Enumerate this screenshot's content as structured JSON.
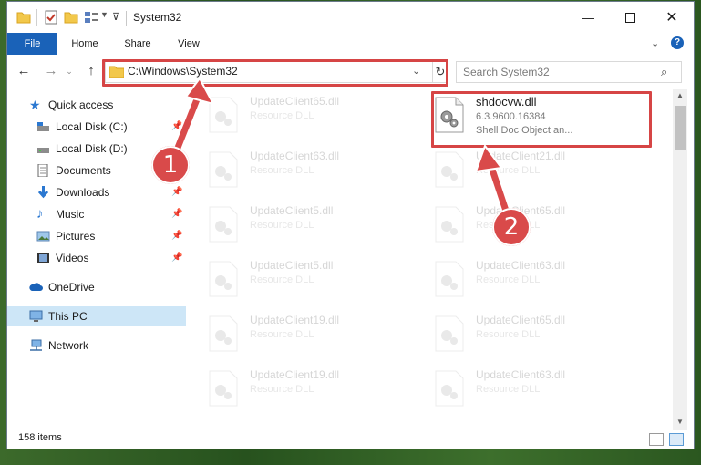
{
  "window": {
    "title": "System32"
  },
  "ribbon": {
    "tabs": [
      "File",
      "Home",
      "Share",
      "View"
    ]
  },
  "address": {
    "path": "C:\\Windows\\System32",
    "search_placeholder": "Search System32"
  },
  "sidebar": {
    "items": [
      {
        "label": "Quick access",
        "icon": "star-icon"
      },
      {
        "label": "Local Disk (C:)",
        "icon": "drive-icon"
      },
      {
        "label": "Local Disk (D:)",
        "icon": "drive-icon"
      },
      {
        "label": "Documents",
        "icon": "document-icon"
      },
      {
        "label": "Downloads",
        "icon": "download-icon"
      },
      {
        "label": "Music",
        "icon": "music-icon"
      },
      {
        "label": "Pictures",
        "icon": "pictures-icon"
      },
      {
        "label": "Videos",
        "icon": "video-icon"
      },
      {
        "label": "OneDrive",
        "icon": "cloud-icon"
      },
      {
        "label": "This PC",
        "icon": "computer-icon"
      },
      {
        "label": "Network",
        "icon": "network-icon"
      }
    ]
  },
  "files": [
    {
      "name": "UpdateClient65.dll",
      "type": "Resource DLL"
    },
    {
      "name": "shdocvw.dll",
      "version": "6.3.9600.16384",
      "desc": "Shell Doc Object an..."
    },
    {
      "name": "UpdateClient63.dll",
      "type": "Resource DLL"
    },
    {
      "name": "UpdateClient21.dll",
      "type": "Resource DLL"
    },
    {
      "name": "UpdateClient5.dll",
      "type": "Resource DLL"
    },
    {
      "name": "UpdateClient65.dll",
      "type": "Resource DLL"
    },
    {
      "name": "UpdateClient5.dll",
      "type": "Resource DLL"
    },
    {
      "name": "UpdateClient63.dll",
      "type": "Resource DLL"
    },
    {
      "name": "UpdateClient19.dll",
      "type": "Resource DLL"
    },
    {
      "name": "UpdateClient65.dll",
      "type": "Resource DLL"
    },
    {
      "name": "UpdateClient19.dll",
      "type": "Resource DLL"
    },
    {
      "name": "UpdateClient63.dll",
      "type": "Resource DLL"
    }
  ],
  "status": {
    "count": "158 items"
  },
  "callouts": [
    "1",
    "2"
  ],
  "colors": {
    "accent": "#1a62b8",
    "highlight": "#d64545",
    "selected": "#cde6f7"
  }
}
